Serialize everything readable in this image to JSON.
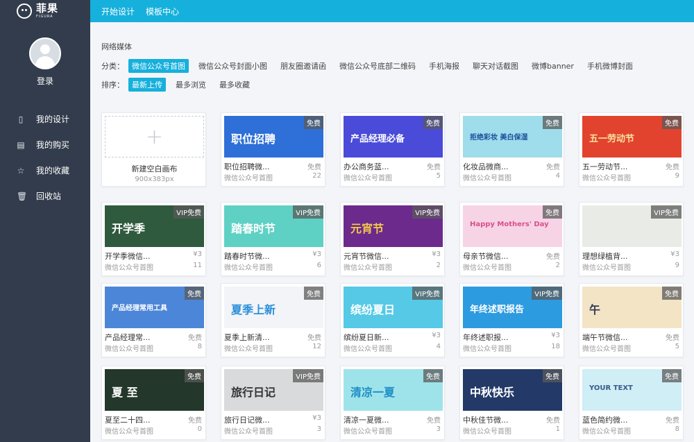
{
  "brand": {
    "name_cn": "菲果",
    "name_en": "FIGURA"
  },
  "sidebar": {
    "login_label": "登录",
    "items": [
      {
        "label": "我的设计",
        "icon": "document-icon"
      },
      {
        "label": "我的购买",
        "icon": "purchase-icon"
      },
      {
        "label": "我的收藏",
        "icon": "star-icon"
      },
      {
        "label": "回收站",
        "icon": "trash-icon"
      }
    ]
  },
  "topbar": {
    "items": [
      "开始设计",
      "模板中心"
    ]
  },
  "filters": {
    "section_title": "网络媒体",
    "category_label": "分类：",
    "categories": [
      "微信公众号首图",
      "微信公众号封面小图",
      "朋友圈邀请函",
      "微信公众号底部二维码",
      "手机海报",
      "聊天对话截图",
      "微博banner",
      "手机微博封面"
    ],
    "active_category": "微信公众号首图",
    "sort_label": "排序：",
    "sorts": [
      "最新上传",
      "最多浏览",
      "最多收藏"
    ],
    "active_sort": "最新上传"
  },
  "new_canvas": {
    "label": "新建空白画布",
    "size": "900x383px"
  },
  "colors": {
    "topbar": "#16b0dc",
    "sidebar": "#333c4c",
    "accent": "#16b0dc"
  },
  "templates": [
    {
      "title": "职位招聘微...",
      "price": "免费",
      "badge": "免费",
      "category": "微信公众号首图",
      "count": "22",
      "thumb_text": "职位招聘",
      "thumb_bg": "#2e6fd8",
      "thumb_fg": "#ffffff"
    },
    {
      "title": "办公商务蓝...",
      "price": "免费",
      "badge": "免费",
      "category": "微信公众号首图",
      "count": "5",
      "thumb_text": "产品经理必备",
      "thumb_bg": "#4a4bd8",
      "thumb_fg": "#ffffff"
    },
    {
      "title": "化妆品微商...",
      "price": "免费",
      "badge": "免费",
      "category": "微信公众号首图",
      "count": "4",
      "thumb_text": "拒绝彩妆 美白保湿",
      "thumb_bg": "#9fdcec",
      "thumb_fg": "#1b4f9a"
    },
    {
      "title": "五一劳动节...",
      "price": "免费",
      "badge": "免费",
      "category": "微信公众号首图",
      "count": "9",
      "thumb_text": "五一劳动节",
      "thumb_bg": "#e2432f",
      "thumb_fg": "#f8e2a0"
    },
    {
      "title": "开学季微信...",
      "price": "¥3",
      "badge": "VIP免费",
      "category": "微信公众号首图",
      "count": "11",
      "thumb_text": "开学季",
      "thumb_bg": "#2f5a3e",
      "thumb_fg": "#ffffff"
    },
    {
      "title": "踏春时节微...",
      "price": "¥3",
      "badge": "VIP免费",
      "category": "微信公众号首图",
      "count": "6",
      "thumb_text": "踏春时节",
      "thumb_bg": "#5fd0c4",
      "thumb_fg": "#ffffff"
    },
    {
      "title": "元宵节微信...",
      "price": "¥3",
      "badge": "VIP免费",
      "category": "微信公众号首图",
      "count": "2",
      "thumb_text": "元宵节",
      "thumb_bg": "#6b2a8c",
      "thumb_fg": "#f5c84a"
    },
    {
      "title": "母亲节微信...",
      "price": "免费",
      "badge": "免费",
      "category": "微信公众号首图",
      "count": "2",
      "thumb_text": "Happy Mothers' Day",
      "thumb_bg": "#f7d3e6",
      "thumb_fg": "#d94f8c"
    },
    {
      "title": "理想绿植背...",
      "price": "¥3",
      "badge": "VIP免费",
      "category": "微信公众号首图",
      "count": "9",
      "thumb_text": "",
      "thumb_bg": "#e9ece6",
      "thumb_fg": "#4b6a4f"
    },
    {
      "title": "产品经理常...",
      "price": "免费",
      "badge": "免费",
      "category": "微信公众号首图",
      "count": "8",
      "thumb_text": "产品经理常用工具",
      "thumb_bg": "#4c86d8",
      "thumb_fg": "#ffffff"
    },
    {
      "title": "夏季上新清...",
      "price": "免费",
      "badge": "免费",
      "category": "微信公众号首图",
      "count": "12",
      "thumb_text": "夏季上新",
      "thumb_bg": "#f2f4f7",
      "thumb_fg": "#2b8fd9"
    },
    {
      "title": "缤纷夏日新...",
      "price": "¥3",
      "badge": "VIP免费",
      "category": "微信公众号首图",
      "count": "4",
      "thumb_text": "缤纷夏日",
      "thumb_bg": "#55c9e6",
      "thumb_fg": "#ffffff"
    },
    {
      "title": "年终述职报...",
      "price": "¥3",
      "badge": "VIP免费",
      "category": "微信公众号首图",
      "count": "18",
      "thumb_text": "年终述职报告",
      "thumb_bg": "#2d9be0",
      "thumb_fg": "#ffffff"
    },
    {
      "title": "端午节微信...",
      "price": "免费",
      "badge": "免费",
      "category": "微信公众号首图",
      "count": "5",
      "thumb_text": "午",
      "thumb_bg": "#f3e4c6",
      "thumb_fg": "#2f3b52"
    },
    {
      "title": "夏至二十四...",
      "price": "免费",
      "badge": "免费",
      "category": "微信公众号首图",
      "count": "0",
      "thumb_text": "夏 至",
      "thumb_bg": "#23372a",
      "thumb_fg": "#ffffff"
    },
    {
      "title": "旅行日记微...",
      "price": "¥3",
      "badge": "VIP免费",
      "category": "微信公众号首图",
      "count": "3",
      "thumb_text": "旅行日记",
      "thumb_bg": "#d9dadc",
      "thumb_fg": "#333333"
    },
    {
      "title": "清凉一夏微...",
      "price": "免费",
      "badge": "免费",
      "category": "微信公众号首图",
      "count": "3",
      "thumb_text": "清凉一夏",
      "thumb_bg": "#9fe3ea",
      "thumb_fg": "#1f8fc5"
    },
    {
      "title": "中秋佳节微...",
      "price": "免费",
      "badge": "免费",
      "category": "微信公众号首图",
      "count": "1",
      "thumb_text": "中秋快乐",
      "thumb_bg": "#233a68",
      "thumb_fg": "#ffffff"
    },
    {
      "title": "蓝色简约微...",
      "price": "免费",
      "badge": "免费",
      "category": "微信公众号首图",
      "count": "8",
      "thumb_text": "YOUR TEXT",
      "thumb_bg": "#cfeef6",
      "thumb_fg": "#3a5a8a"
    }
  ]
}
